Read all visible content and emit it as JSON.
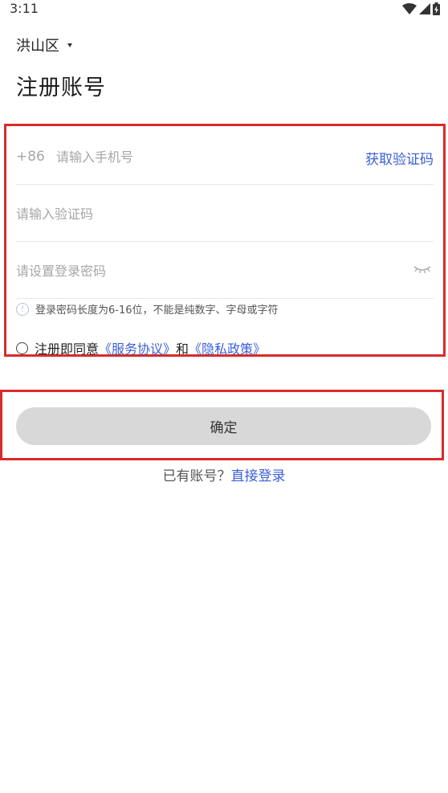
{
  "status_bar": {
    "time": "3:11",
    "icons": [
      "wifi-icon",
      "signal-icon",
      "battery-charging-icon"
    ]
  },
  "header": {
    "region_label": "洪山区",
    "title": "注册账号"
  },
  "form": {
    "phone_prefix": "+86",
    "phone_placeholder": "请输入手机号",
    "get_code_label": "获取验证码",
    "code_placeholder": "请输入验证码",
    "password_placeholder": "请设置登录密码",
    "password_hint": "登录密码长度为6-16位，不能是纯数字、字母或字符",
    "agreement": {
      "prefix": "注册即同意",
      "terms_link": "《服务协议》",
      "conjunction": "和",
      "privacy_link": "《隐私政策》"
    }
  },
  "confirm_label": "确定",
  "login_prompt": {
    "text": "已有账号？",
    "link": "直接登录"
  },
  "colors": {
    "accent": "#3a5fd8",
    "highlight_border": "#d92b2b",
    "button_bg": "#d8d8d8",
    "placeholder": "#a6a6a6"
  }
}
